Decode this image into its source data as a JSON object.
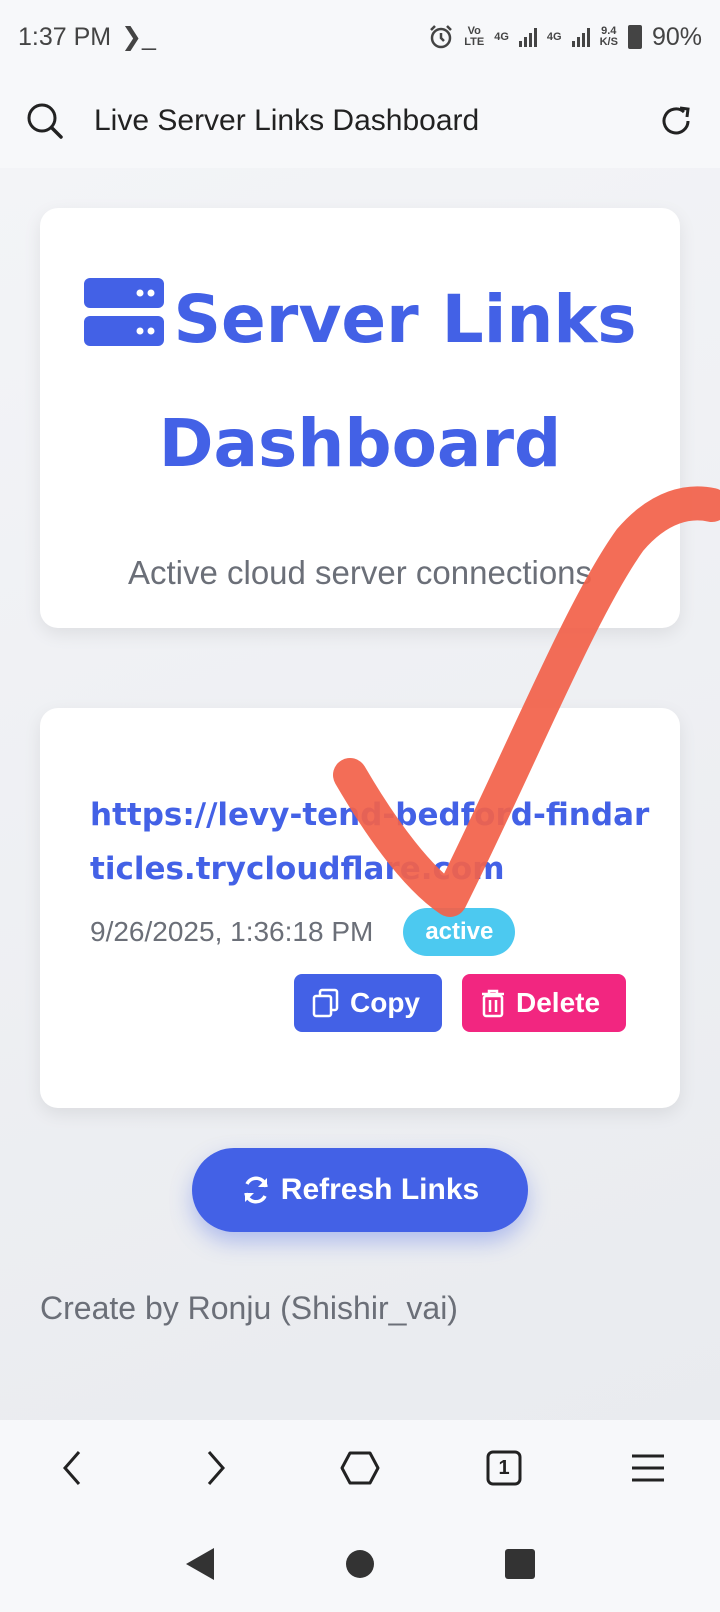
{
  "status_bar": {
    "time": "1:37 PM",
    "terminal_glyph": "❯_",
    "volte_top": "Vo",
    "volte_bottom": "LTE",
    "net1": "4G",
    "net2": "4G",
    "speed_top": "9.4",
    "speed_bottom": "K/S",
    "battery": "90%"
  },
  "address_bar": {
    "title": "Live Server Links Dashboard",
    "icons": [
      "search-icon",
      "reload-icon"
    ]
  },
  "header": {
    "title": "Server Links Dashboard",
    "subtitle": "Active cloud server connections",
    "icon": "server-icon",
    "accent": "#4361e6"
  },
  "links": [
    {
      "url": "https://levy-tend-bedford-findarticles.trycloudflare.com",
      "timestamp": "9/26/2025, 1:36:18 PM",
      "status": "active",
      "copy_label": "Copy",
      "delete_label": "Delete"
    }
  ],
  "refresh_label": "Refresh Links",
  "footer": {
    "credit": "Create by Ronju (Shishir_vai)"
  },
  "browser_nav": {
    "icons": [
      "back-icon",
      "forward-icon",
      "home-icon",
      "tabs-icon",
      "menu-icon"
    ],
    "tab_count": "1"
  },
  "system_nav": {
    "icons": [
      "back-triangle-icon",
      "home-circle-icon",
      "recents-square-icon"
    ]
  },
  "colors": {
    "primary": "#4361e6",
    "danger": "#f22680",
    "badge": "#4cc9f0",
    "annotation": "#f2624a"
  }
}
